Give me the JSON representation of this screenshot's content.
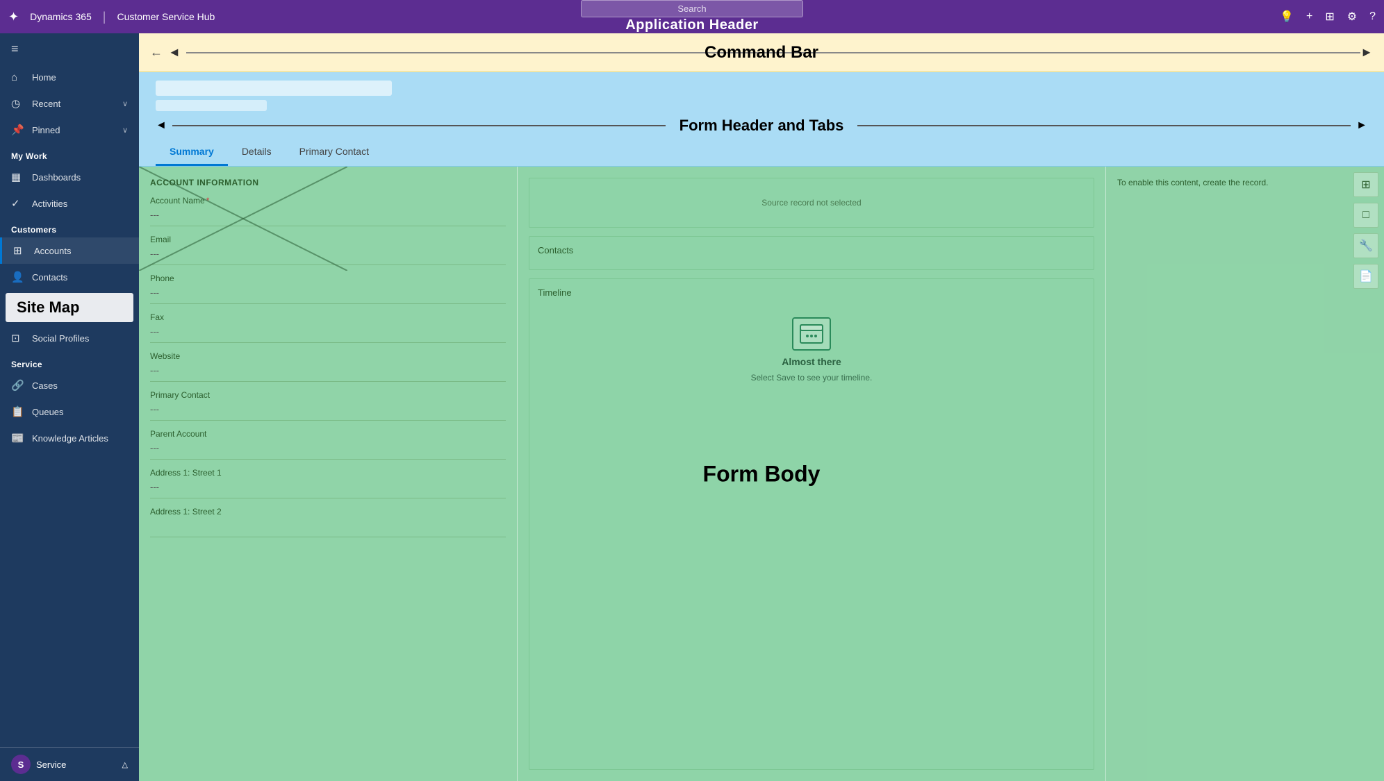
{
  "app_header": {
    "logo": "⚙",
    "title": "Dynamics 365",
    "separator": "|",
    "app_name": "Customer Service Hub",
    "search_placeholder": "Search",
    "label": "Application Header",
    "icons": {
      "lightbulb": "💡",
      "plus": "+",
      "filter": "⊞",
      "gear": "⚙",
      "question": "?"
    }
  },
  "command_bar": {
    "label": "Command Bar",
    "back_icon": "←",
    "arrow_left": "◄",
    "arrow_right": "►"
  },
  "form_header": {
    "label": "Form Header and Tabs",
    "arrow_left": "◄",
    "arrow_right": "►",
    "tabs": [
      {
        "id": "summary",
        "label": "Summary",
        "active": true
      },
      {
        "id": "details",
        "label": "Details",
        "active": false
      },
      {
        "id": "primary-contact",
        "label": "Primary Contact",
        "active": false
      }
    ]
  },
  "sidebar": {
    "toggle_icon": "≡",
    "nav_items": [
      {
        "id": "home",
        "icon": "⌂",
        "label": "Home",
        "has_chevron": false
      },
      {
        "id": "recent",
        "icon": "◷",
        "label": "Recent",
        "has_chevron": true
      },
      {
        "id": "pinned",
        "icon": "📌",
        "label": "Pinned",
        "has_chevron": true
      }
    ],
    "sections": [
      {
        "label": "My Work",
        "items": [
          {
            "id": "dashboards",
            "icon": "▦",
            "label": "Dashboards"
          },
          {
            "id": "activities",
            "icon": "✓",
            "label": "Activities"
          }
        ]
      },
      {
        "label": "Customers",
        "items": [
          {
            "id": "accounts",
            "icon": "⊞",
            "label": "Accounts",
            "active": true
          },
          {
            "id": "contacts",
            "icon": "👤",
            "label": "Contacts"
          },
          {
            "id": "social-profiles",
            "icon": "⊡",
            "label": "Social Profiles"
          }
        ]
      },
      {
        "label": "Service",
        "items": [
          {
            "id": "cases",
            "icon": "🔗",
            "label": "Cases"
          },
          {
            "id": "queues",
            "icon": "📋",
            "label": "Queues"
          },
          {
            "id": "knowledge-articles",
            "icon": "📰",
            "label": "Knowledge Articles"
          }
        ]
      }
    ],
    "sitemap_label": "Site Map",
    "bottom": {
      "icon": "S",
      "label": "Service",
      "chevron": "△"
    }
  },
  "form_body": {
    "label": "Form Body",
    "left_column": {
      "section_title": "ACCOUNT INFORMATION",
      "fields": [
        {
          "id": "account-name",
          "label": "Account Name",
          "required": true,
          "value": "---"
        },
        {
          "id": "email",
          "label": "Email",
          "required": false,
          "value": "---"
        },
        {
          "id": "phone",
          "label": "Phone",
          "required": false,
          "value": "---"
        },
        {
          "id": "fax",
          "label": "Fax",
          "required": false,
          "value": "---"
        },
        {
          "id": "website",
          "label": "Website",
          "required": false,
          "value": "---"
        },
        {
          "id": "primary-contact",
          "label": "Primary Contact",
          "required": false,
          "value": "---"
        },
        {
          "id": "parent-account",
          "label": "Parent Account",
          "required": false,
          "value": "---"
        },
        {
          "id": "address1-street1",
          "label": "Address 1: Street 1",
          "required": false,
          "value": "---"
        },
        {
          "id": "address1-street2",
          "label": "Address 1: Street 2",
          "required": false,
          "value": ""
        }
      ]
    },
    "middle_column": {
      "source_record": {
        "label": "",
        "empty_message": "Source record not selected"
      },
      "contacts": {
        "label": "Contacts"
      },
      "timeline": {
        "label": "Timeline",
        "icon_label": "Almost there",
        "icon_sublabel": "Select Save to see your timeline."
      }
    },
    "right_column": {
      "enable_message": "To enable this content, create the record.",
      "icons": [
        "⊞",
        "□",
        "🔧",
        "📄"
      ]
    }
  }
}
